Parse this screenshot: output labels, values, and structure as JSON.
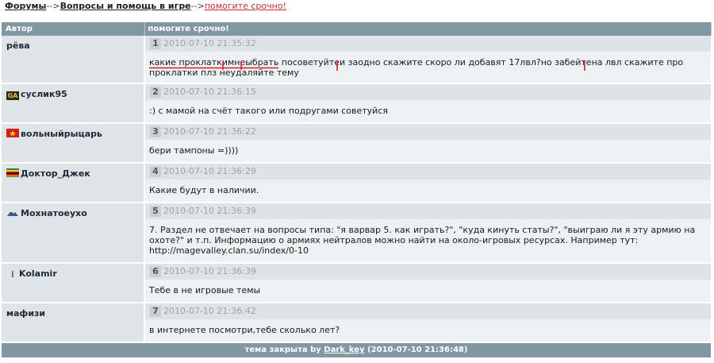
{
  "breadcrumb": {
    "root": "Форумы",
    "sep1": "-->",
    "section": "Вопросы и помощь в игре",
    "sep2": "-->",
    "topic": "помогите срочно!"
  },
  "table": {
    "col_author": "Автор",
    "col_topic": "помогите срочно!"
  },
  "posts": [
    {
      "author": "рёва",
      "num": "1",
      "date": "2010-07-10 21:35:32",
      "text": "какие проклаткимнеыбрать посоветуйтеи заодно скажите скоро ли добавят 17лвл?но забейтена лвл скажите про проклатки плз неудаляйте тему"
    },
    {
      "author": "суслик95",
      "num": "2",
      "date": "2010-07-10 21:36:15",
      "text": ":) с мамой на счёт такого или подругами советуйся"
    },
    {
      "author": "вольныйрыцарь",
      "num": "3",
      "date": "2010-07-10 21:36:22",
      "text": "бери тампоны =))))"
    },
    {
      "author": "Доктор_Джек",
      "num": "4",
      "date": "2010-07-10 21:36:29",
      "text": "Какие будут в наличии."
    },
    {
      "author": "Мохнатоеухо",
      "num": "5",
      "date": "2010-07-10 21:36:39",
      "text": "7. Раздел не отвечает на вопросы типа: \"я варвар 5. как играть?\", \"куда кинуть статы?\", \"выиграю ли я эту армию на охоте?\" и т.п. Информацию о армиях нейтралов можно найти на около-игровых ресурсах. Например тут: http://magevalley.clan.su/index/0-10"
    },
    {
      "author": "Kolamir",
      "num": "6",
      "date": "2010-07-10 21:36:39",
      "text": "Тебе в не игровые темы"
    },
    {
      "author": "мафизи",
      "num": "7",
      "date": "2010-07-10 21:36:42",
      "text": "в интернете посмотри,тебе сколько лет?"
    }
  ],
  "footer": {
    "prefix": "тема закрыта by",
    "user": "Dark_key",
    "time": "(2010-07-10 21:36:48)"
  },
  "colors": {
    "header_bg": "#8397a3",
    "author_bg": "#dee4e8",
    "body_bg": "#eef1f3",
    "annotation_red": "#d42020"
  }
}
